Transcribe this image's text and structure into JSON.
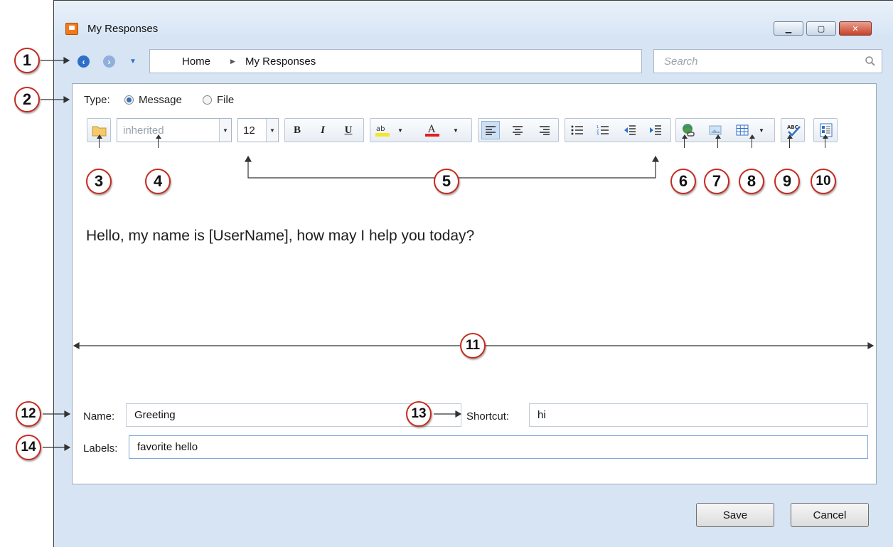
{
  "window": {
    "title": "My Responses"
  },
  "nav": {
    "breadcrumb": [
      "Home",
      "My Responses"
    ],
    "search_placeholder": "Search"
  },
  "type": {
    "label": "Type:",
    "options": [
      "Message",
      "File"
    ],
    "selected": "Message"
  },
  "toolbar": {
    "font": "inherited",
    "font_size": "12",
    "bold": "B",
    "italic": "I",
    "underline": "U"
  },
  "message": "Hello, my name is [UserName], how may I help you today?",
  "form": {
    "name_label": "Name:",
    "name_value": "Greeting",
    "shortcut_label": "Shortcut:",
    "shortcut_value": "hi",
    "labels_label": "Labels:",
    "labels_value": "favorite hello"
  },
  "buttons": {
    "save": "Save",
    "cancel": "Cancel"
  },
  "callouts": [
    "1",
    "2",
    "3",
    "4",
    "5",
    "6",
    "7",
    "8",
    "9",
    "10",
    "11",
    "12",
    "13",
    "14"
  ],
  "colors": {
    "callout_border": "#c62b1f",
    "title_icon": "#f07a1c",
    "nav_blue": "#2f6fc9"
  }
}
